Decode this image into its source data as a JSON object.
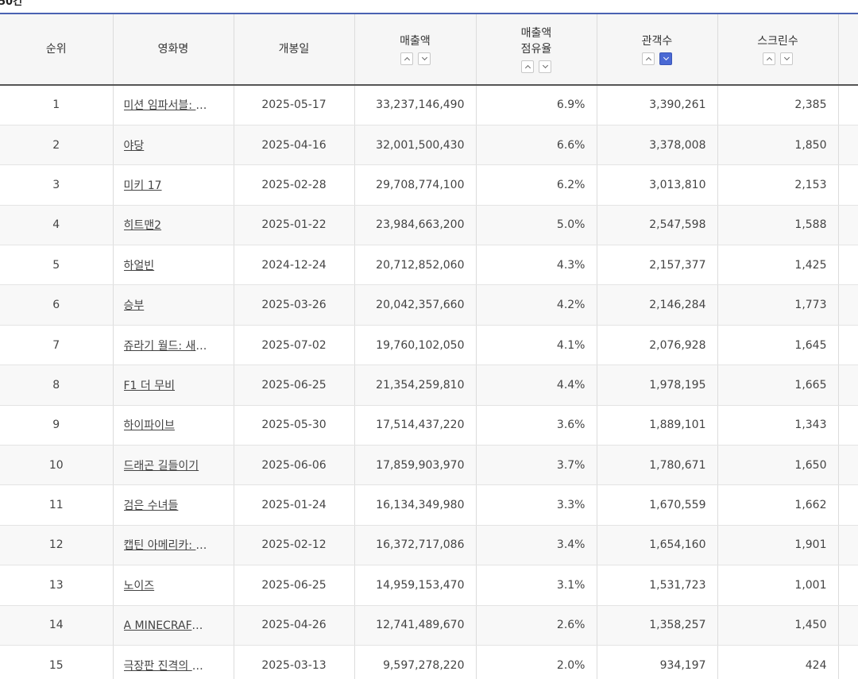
{
  "header_fragment": "50건",
  "columns": {
    "rank": "순위",
    "title": "영화명",
    "open_date": "개봉일",
    "sales": "매출액",
    "share_line1": "매출액",
    "share_line2": "점유율",
    "audience": "관객수",
    "screens": "스크린수"
  },
  "sort": {
    "active_column": "audience",
    "active_direction": "desc"
  },
  "rows": [
    {
      "rank": "1",
      "title": "미션 임파서블: 파이널 레코닝",
      "date": "2025-05-17",
      "sales": "33,237,146,490",
      "share": "6.9%",
      "audience": "3,390,261",
      "screens": "2,385"
    },
    {
      "rank": "2",
      "title": "야당",
      "date": "2025-04-16",
      "sales": "32,001,500,430",
      "share": "6.6%",
      "audience": "3,378,008",
      "screens": "1,850"
    },
    {
      "rank": "3",
      "title": "미키 17",
      "date": "2025-02-28",
      "sales": "29,708,774,100",
      "share": "6.2%",
      "audience": "3,013,810",
      "screens": "2,153"
    },
    {
      "rank": "4",
      "title": "히트맨2",
      "date": "2025-01-22",
      "sales": "23,984,663,200",
      "share": "5.0%",
      "audience": "2,547,598",
      "screens": "1,588"
    },
    {
      "rank": "5",
      "title": "하얼빈",
      "date": "2024-12-24",
      "sales": "20,712,852,060",
      "share": "4.3%",
      "audience": "2,157,377",
      "screens": "1,425"
    },
    {
      "rank": "6",
      "title": "승부",
      "date": "2025-03-26",
      "sales": "20,042,357,660",
      "share": "4.2%",
      "audience": "2,146,284",
      "screens": "1,773"
    },
    {
      "rank": "7",
      "title": "쥬라기 월드: 새로운 시작",
      "date": "2025-07-02",
      "sales": "19,760,102,050",
      "share": "4.1%",
      "audience": "2,076,928",
      "screens": "1,645"
    },
    {
      "rank": "8",
      "title": "F1 더 무비",
      "date": "2025-06-25",
      "sales": "21,354,259,810",
      "share": "4.4%",
      "audience": "1,978,195",
      "screens": "1,665"
    },
    {
      "rank": "9",
      "title": "하이파이브",
      "date": "2025-05-30",
      "sales": "17,514,437,220",
      "share": "3.6%",
      "audience": "1,889,101",
      "screens": "1,343"
    },
    {
      "rank": "10",
      "title": "드래곤 길들이기",
      "date": "2025-06-06",
      "sales": "17,859,903,970",
      "share": "3.7%",
      "audience": "1,780,671",
      "screens": "1,650"
    },
    {
      "rank": "11",
      "title": "검은 수녀들",
      "date": "2025-01-24",
      "sales": "16,134,349,980",
      "share": "3.3%",
      "audience": "1,670,559",
      "screens": "1,662"
    },
    {
      "rank": "12",
      "title": "캡틴 아메리카: 브레이브 뉴 월드",
      "date": "2025-02-12",
      "sales": "16,372,717,086",
      "share": "3.4%",
      "audience": "1,654,160",
      "screens": "1,901"
    },
    {
      "rank": "13",
      "title": "노이즈",
      "date": "2025-06-25",
      "sales": "14,959,153,470",
      "share": "3.1%",
      "audience": "1,531,723",
      "screens": "1,001"
    },
    {
      "rank": "14",
      "title": "A MINECRAFT MOVIE 마인크래프트 무비",
      "date": "2025-04-26",
      "sales": "12,741,489,670",
      "share": "2.6%",
      "audience": "1,358,257",
      "screens": "1,450"
    },
    {
      "rank": "15",
      "title": "극장판 진격의 거인 완결편 더 라스트 어택",
      "date": "2025-03-13",
      "sales": "9,597,278,220",
      "share": "2.0%",
      "audience": "934,197",
      "screens": "424"
    }
  ]
}
